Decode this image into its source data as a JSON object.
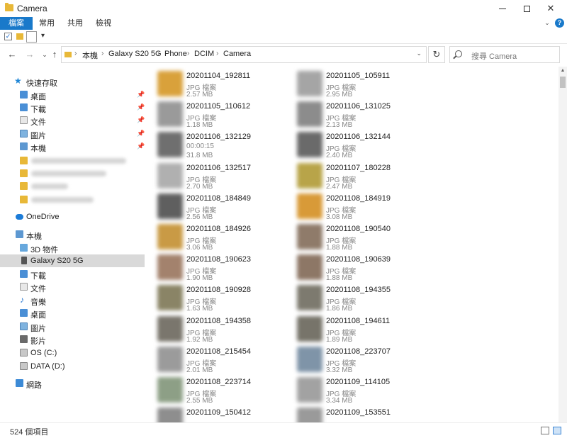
{
  "window": {
    "title": "Camera"
  },
  "ribbon": {
    "tabs": [
      "檔案",
      "常用",
      "共用",
      "檢視"
    ]
  },
  "address": {
    "segments": [
      "本機",
      "Galaxy S20 5G",
      "Phone",
      "DCIM",
      "Camera"
    ],
    "search_placeholder": "搜尋 Camera"
  },
  "sidebar": {
    "quick_access": "快速存取",
    "pinned": [
      {
        "label": "桌面",
        "icon": "desktop-icon"
      },
      {
        "label": "下載",
        "icon": "download-icon"
      },
      {
        "label": "文件",
        "icon": "document-icon"
      },
      {
        "label": "圖片",
        "icon": "picture-icon"
      },
      {
        "label": "本機",
        "icon": "pc-icon"
      }
    ],
    "onedrive": "OneDrive",
    "this_pc": "本機",
    "pc_items": [
      {
        "label": "3D 物件",
        "icon": "3d-objects-icon"
      },
      {
        "label": "Galaxy S20 5G",
        "icon": "phone-icon"
      },
      {
        "label": "下載",
        "icon": "download-icon"
      },
      {
        "label": "文件",
        "icon": "document-icon"
      },
      {
        "label": "音樂",
        "icon": "music-icon"
      },
      {
        "label": "桌面",
        "icon": "desktop-icon"
      },
      {
        "label": "圖片",
        "icon": "picture-icon"
      },
      {
        "label": "影片",
        "icon": "video-icon"
      },
      {
        "label": "OS (C:)",
        "icon": "drive-icon"
      },
      {
        "label": "DATA (D:)",
        "icon": "drive-icon"
      }
    ],
    "network": "網路"
  },
  "files": [
    {
      "name": "20201104_192811",
      "type": "JPG 檔案",
      "size": "2.57 MB",
      "color": "#d9a13b"
    },
    {
      "name": "20201105_105911",
      "type": "JPG 檔案",
      "size": "2.95 MB",
      "color": "#a5a5a5"
    },
    {
      "name": "20201105_110612",
      "type": "JPG 檔案",
      "size": "1.18 MB",
      "color": "#9a9a9a"
    },
    {
      "name": "20201106_131025",
      "type": "JPG 檔案",
      "size": "2.13 MB",
      "color": "#8c8c8c"
    },
    {
      "name": "20201106_132129",
      "type": "00:00:15",
      "size": "31.8 MB",
      "color": "#6f6f6f"
    },
    {
      "name": "20201106_132144",
      "type": "JPG 檔案",
      "size": "2.40 MB",
      "color": "#6a6a6a"
    },
    {
      "name": "20201106_132517",
      "type": "JPG 檔案",
      "size": "2.70 MB",
      "color": "#b0b0b0"
    },
    {
      "name": "20201107_180228",
      "type": "JPG 檔案",
      "size": "2.47 MB",
      "color": "#b8a449"
    },
    {
      "name": "20201108_184849",
      "type": "JPG 檔案",
      "size": "2.56 MB",
      "color": "#5f5f5f"
    },
    {
      "name": "20201108_184919",
      "type": "JPG 檔案",
      "size": "3.08 MB",
      "color": "#d89a38"
    },
    {
      "name": "20201108_184926",
      "type": "JPG 檔案",
      "size": "3.06 MB",
      "color": "#c99a45"
    },
    {
      "name": "20201108_190540",
      "type": "JPG 檔案",
      "size": "1.88 MB",
      "color": "#8f7b6a"
    },
    {
      "name": "20201108_190623",
      "type": "JPG 檔案",
      "size": "1.90 MB",
      "color": "#a3826d"
    },
    {
      "name": "20201108_190639",
      "type": "JPG 檔案",
      "size": "1.88 MB",
      "color": "#8d7766"
    },
    {
      "name": "20201108_190928",
      "type": "JPG 檔案",
      "size": "1.63 MB",
      "color": "#8a8466"
    },
    {
      "name": "20201108_194355",
      "type": "JPG 檔案",
      "size": "1.86 MB",
      "color": "#7d7a6f"
    },
    {
      "name": "20201108_194358",
      "type": "JPG 檔案",
      "size": "1.92 MB",
      "color": "#7a766d"
    },
    {
      "name": "20201108_194611",
      "type": "JPG 檔案",
      "size": "1.89 MB",
      "color": "#77746a"
    },
    {
      "name": "20201108_215454",
      "type": "JPG 檔案",
      "size": "2.01 MB",
      "color": "#9b9b9b"
    },
    {
      "name": "20201108_223707",
      "type": "JPG 檔案",
      "size": "3.32 MB",
      "color": "#7f94a8"
    },
    {
      "name": "20201108_223714",
      "type": "JPG 檔案",
      "size": "2.55 MB",
      "color": "#8d9f86"
    },
    {
      "name": "20201109_114105",
      "type": "JPG 檔案",
      "size": "3.34 MB",
      "color": "#a2a2a2"
    },
    {
      "name": "20201109_150412",
      "type": "",
      "size": "",
      "color": "#8e8e8e"
    },
    {
      "name": "20201109_153551",
      "type": "",
      "size": "",
      "color": "#9a9a9a"
    }
  ],
  "status": {
    "count": "524 個項目"
  }
}
